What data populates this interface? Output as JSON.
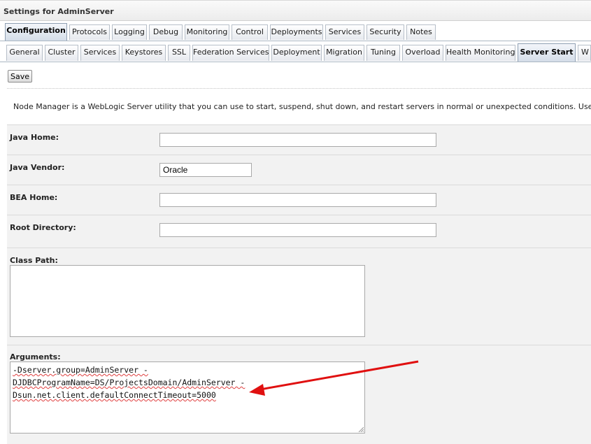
{
  "header": {
    "title": "Settings for AdminServer"
  },
  "tabs_primary": [
    {
      "label": "Configuration",
      "active": true
    },
    {
      "label": "Protocols"
    },
    {
      "label": "Logging"
    },
    {
      "label": "Debug"
    },
    {
      "label": "Monitoring"
    },
    {
      "label": "Control"
    },
    {
      "label": "Deployments"
    },
    {
      "label": "Services"
    },
    {
      "label": "Security"
    },
    {
      "label": "Notes"
    }
  ],
  "tabs_secondary": [
    {
      "label": "General"
    },
    {
      "label": "Cluster"
    },
    {
      "label": "Services"
    },
    {
      "label": "Keystores"
    },
    {
      "label": "SSL"
    },
    {
      "label": "Federation Services"
    },
    {
      "label": "Deployment"
    },
    {
      "label": "Migration"
    },
    {
      "label": "Tuning"
    },
    {
      "label": "Overload"
    },
    {
      "label": "Health Monitoring"
    },
    {
      "label": "Server Start",
      "active": true
    },
    {
      "label": "W"
    }
  ],
  "toolbar": {
    "save_label": "Save"
  },
  "description": "Node Manager is a WebLogic Server utility that you can use to start, suspend, shut down, and restart servers in normal or unexpected conditions. Use this page to configu",
  "fields": {
    "java_home": {
      "label": "Java Home:",
      "value": ""
    },
    "java_vendor": {
      "label": "Java Vendor:",
      "value": "Oracle"
    },
    "bea_home": {
      "label": "BEA Home:",
      "value": ""
    },
    "root_directory": {
      "label": "Root Directory:",
      "value": ""
    },
    "class_path": {
      "label": "Class Path:",
      "value": ""
    },
    "arguments": {
      "label": "Arguments:",
      "lines": [
        "-Dserver.group=AdminServer -",
        "DJDBCProgramName=DS/ProjectsDomain/AdminServer -",
        "Dsun.net.client.defaultConnectTimeout=5000"
      ]
    }
  },
  "annotation": {
    "arrow_color": "#e01010"
  },
  "colors": {
    "active_tab_bg": "#d4dde8",
    "row_bg": "#f2f2f2"
  }
}
